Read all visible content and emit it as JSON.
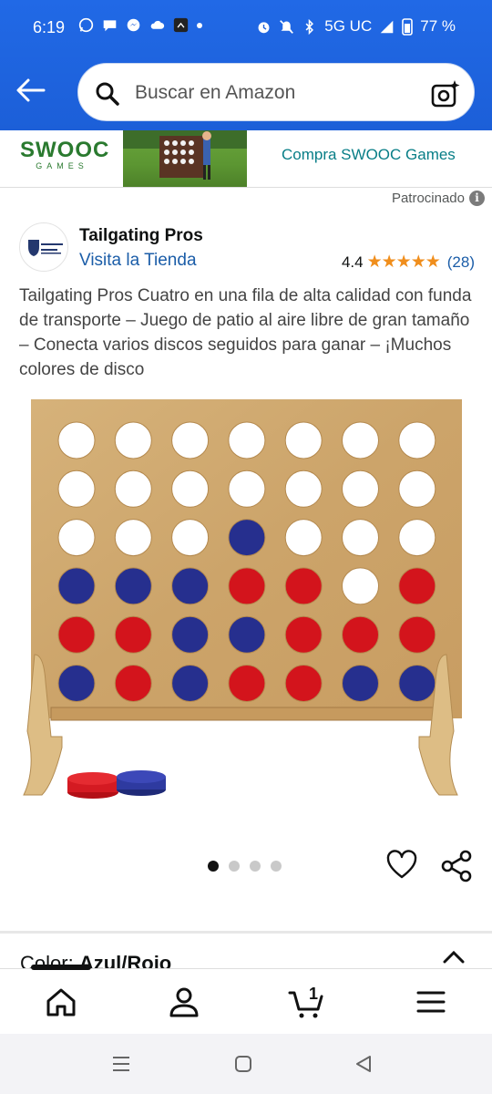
{
  "status_bar": {
    "time": "6:19",
    "network": "5G UC",
    "battery": "77 %"
  },
  "search": {
    "placeholder": "Buscar en Amazon"
  },
  "ad_banner": {
    "brand": "SWOOC",
    "brand_sub": "GAMES",
    "cta": "Compra SWOOC Games",
    "sponsored": "Patrocinado"
  },
  "seller": {
    "name": "Tailgating Pros",
    "store_link": "Visita la Tienda",
    "rating": "4.4",
    "stars": "★★★★★",
    "reviews": "(28)"
  },
  "product": {
    "title": "Tailgating Pros Cuatro en una fila de alta calidad con funda de transporte – Juego de patio al aire libre de gran tamaño – Conecta varios discos seguidos para ganar – ¡Muchos colores de disco",
    "image_count": 4,
    "active_image": 1
  },
  "variant": {
    "label": "Color:",
    "value": "Azul/Rojo"
  },
  "bottom_nav": {
    "cart_count": "1",
    "items": [
      "home-icon",
      "account-icon",
      "cart-icon",
      "menu-icon"
    ]
  },
  "colors": {
    "accent_blue": "#1c5fd8",
    "link": "#1b5da8",
    "star": "#f08e1c",
    "teal": "#087e87"
  }
}
